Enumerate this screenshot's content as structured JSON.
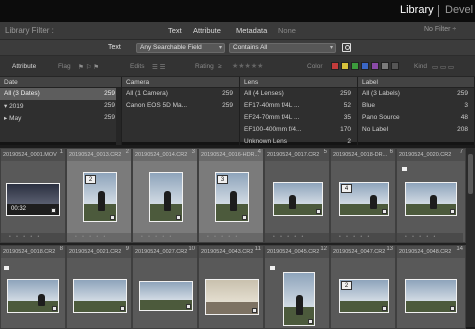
{
  "modules": {
    "library": "Library",
    "develop": "Devel"
  },
  "filter_bar": {
    "title": "Library Filter :",
    "tabs": [
      "Text",
      "Attribute",
      "Metadata",
      "None"
    ],
    "preset": "No Filter ÷"
  },
  "text_row": {
    "label": "Text",
    "field": "Any Searchable Field",
    "rule": "Contains All"
  },
  "attribute_row": {
    "label": "Attribute",
    "flag": "Flag",
    "edits": "Edits",
    "rating": "Rating",
    "color": "Color",
    "kind": "Kind",
    "stars": "★★★★★",
    "colors": [
      "#c23b3b",
      "#d8c33b",
      "#3c9a3c",
      "#3a66c5",
      "#8a4aa8",
      "#7a7a7a",
      "#555555"
    ]
  },
  "columns": [
    {
      "header": "Date",
      "rows": [
        {
          "label": "All (3 Dates)",
          "count": "259",
          "selected": true
        },
        {
          "label": "▾ 2019",
          "count": "259"
        },
        {
          "label": "  ▸ May",
          "count": "259"
        }
      ]
    },
    {
      "header": "Camera",
      "rows": [
        {
          "label": "All (1 Camera)",
          "count": "259"
        },
        {
          "label": "Canon EOS 5D Ma...",
          "count": "259"
        }
      ]
    },
    {
      "header": "Lens",
      "rows": [
        {
          "label": "All (4 Lenses)",
          "count": "259"
        },
        {
          "label": "EF17-40mm f/4L ...",
          "count": "52"
        },
        {
          "label": "EF24-70mm f/4L ...",
          "count": "35"
        },
        {
          "label": "EF100-400mm f/4...",
          "count": "170"
        },
        {
          "label": "Unknown Lens",
          "count": "2"
        }
      ]
    },
    {
      "header": "Label",
      "rows": [
        {
          "label": "All (3 Labels)",
          "count": "259"
        },
        {
          "label": "Blue",
          "count": "3"
        },
        {
          "label": "Pano Source",
          "count": "48"
        },
        {
          "label": "No Label",
          "count": "208"
        }
      ]
    }
  ],
  "grid": {
    "row1": [
      {
        "index": "1",
        "name": "20190524_0001.MOV",
        "duration": "00:32"
      },
      {
        "index": "2",
        "name": "20190524_0013.CR2",
        "stack": "2",
        "selected": true
      },
      {
        "index": "3",
        "name": "20190524_0014.CR2",
        "selected": true
      },
      {
        "index": "4",
        "name": "20190524_0016-HDR...",
        "stack": "3",
        "selected": true
      },
      {
        "index": "5",
        "name": "20190524_0017.CR2"
      },
      {
        "index": "6",
        "name": "20190524_0018-DR...",
        "stack": "4"
      },
      {
        "index": "7",
        "name": "20190524_0020.CR2"
      }
    ],
    "row2": [
      {
        "index": "8",
        "name": "20190524_0018.CR2"
      },
      {
        "index": "9",
        "name": "20190524_0021.CR2"
      },
      {
        "index": "10",
        "name": "20190524_0027.CR2"
      },
      {
        "index": "11",
        "name": "20190524_0043.CR2"
      },
      {
        "index": "12",
        "name": "20190524_0045.CR2"
      },
      {
        "index": "13",
        "name": "20190524_0047.CR2",
        "stack": "2"
      },
      {
        "index": "14",
        "name": "20190524_0048.CR2"
      }
    ]
  }
}
